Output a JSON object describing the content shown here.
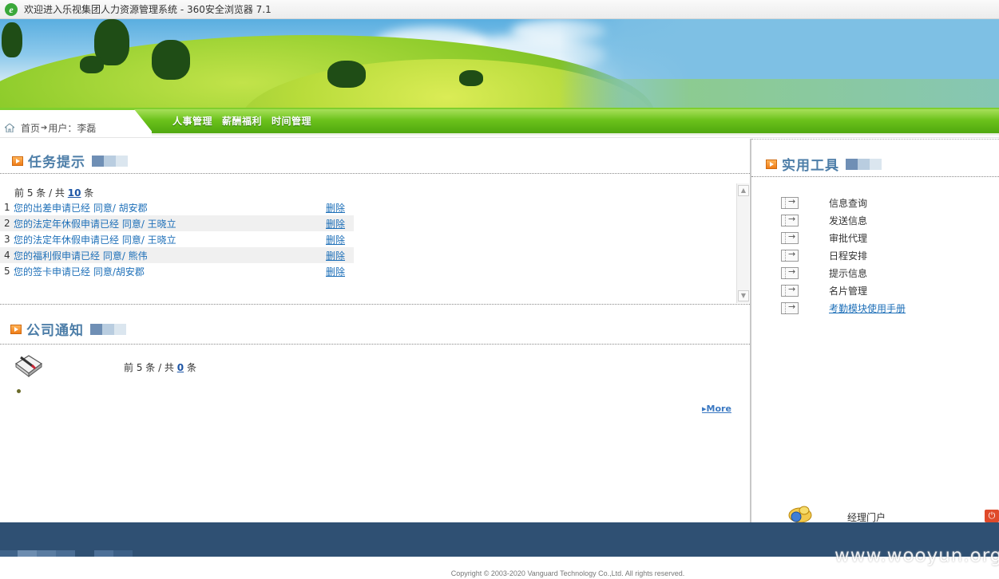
{
  "browser": {
    "title": "欢迎进入乐视集团人力资源管理系统 - 360安全浏览器 7.1"
  },
  "nav": {
    "home_label": "首页",
    "user_label": "用户：李磊",
    "menu": [
      {
        "label": "人事管理"
      },
      {
        "label": "薪酬福利"
      },
      {
        "label": "时间管理"
      }
    ]
  },
  "tasks": {
    "title": "任务提示",
    "count_prefix": "前 5 条 / 共 ",
    "count_total": "10",
    "count_suffix": " 条",
    "items": [
      {
        "index": "1",
        "text": "您的出差申请已经 同意/ 胡安郡",
        "action": "删除"
      },
      {
        "index": "2",
        "text": "您的法定年休假申请已经 同意/ 王晓立",
        "action": "删除"
      },
      {
        "index": "3",
        "text": "您的法定年休假申请已经 同意/ 王晓立",
        "action": "删除"
      },
      {
        "index": "4",
        "text": "您的福利假申请已经 同意/ 熊伟",
        "action": "删除"
      },
      {
        "index": "5",
        "text": "您的签卡申请已经 同意/胡安郡",
        "action": "删除"
      }
    ]
  },
  "notices": {
    "title": "公司通知",
    "count_prefix": "前 5 条 / 共 ",
    "count_total": "0",
    "count_suffix": " 条",
    "more_label": "More"
  },
  "tools": {
    "title": "实用工具",
    "items": [
      {
        "label": "信息查询"
      },
      {
        "label": "发送信息"
      },
      {
        "label": "审批代理"
      },
      {
        "label": "日程安排"
      },
      {
        "label": "提示信息"
      },
      {
        "label": "名片管理"
      },
      {
        "label": "考勤模块使用手册"
      }
    ],
    "portal_label": "经理门户"
  },
  "footer": {
    "copyright": "Copyright © 2003-2020 Vanguard Technology Co.,Ltd. All rights reserved.",
    "watermark": "www.wooyun.org"
  },
  "colors": {
    "nav_green": "#6cc21c",
    "section_title": "#4d7ea8",
    "link_blue": "#1d6fb8",
    "footer_bar": "#2f5073"
  }
}
